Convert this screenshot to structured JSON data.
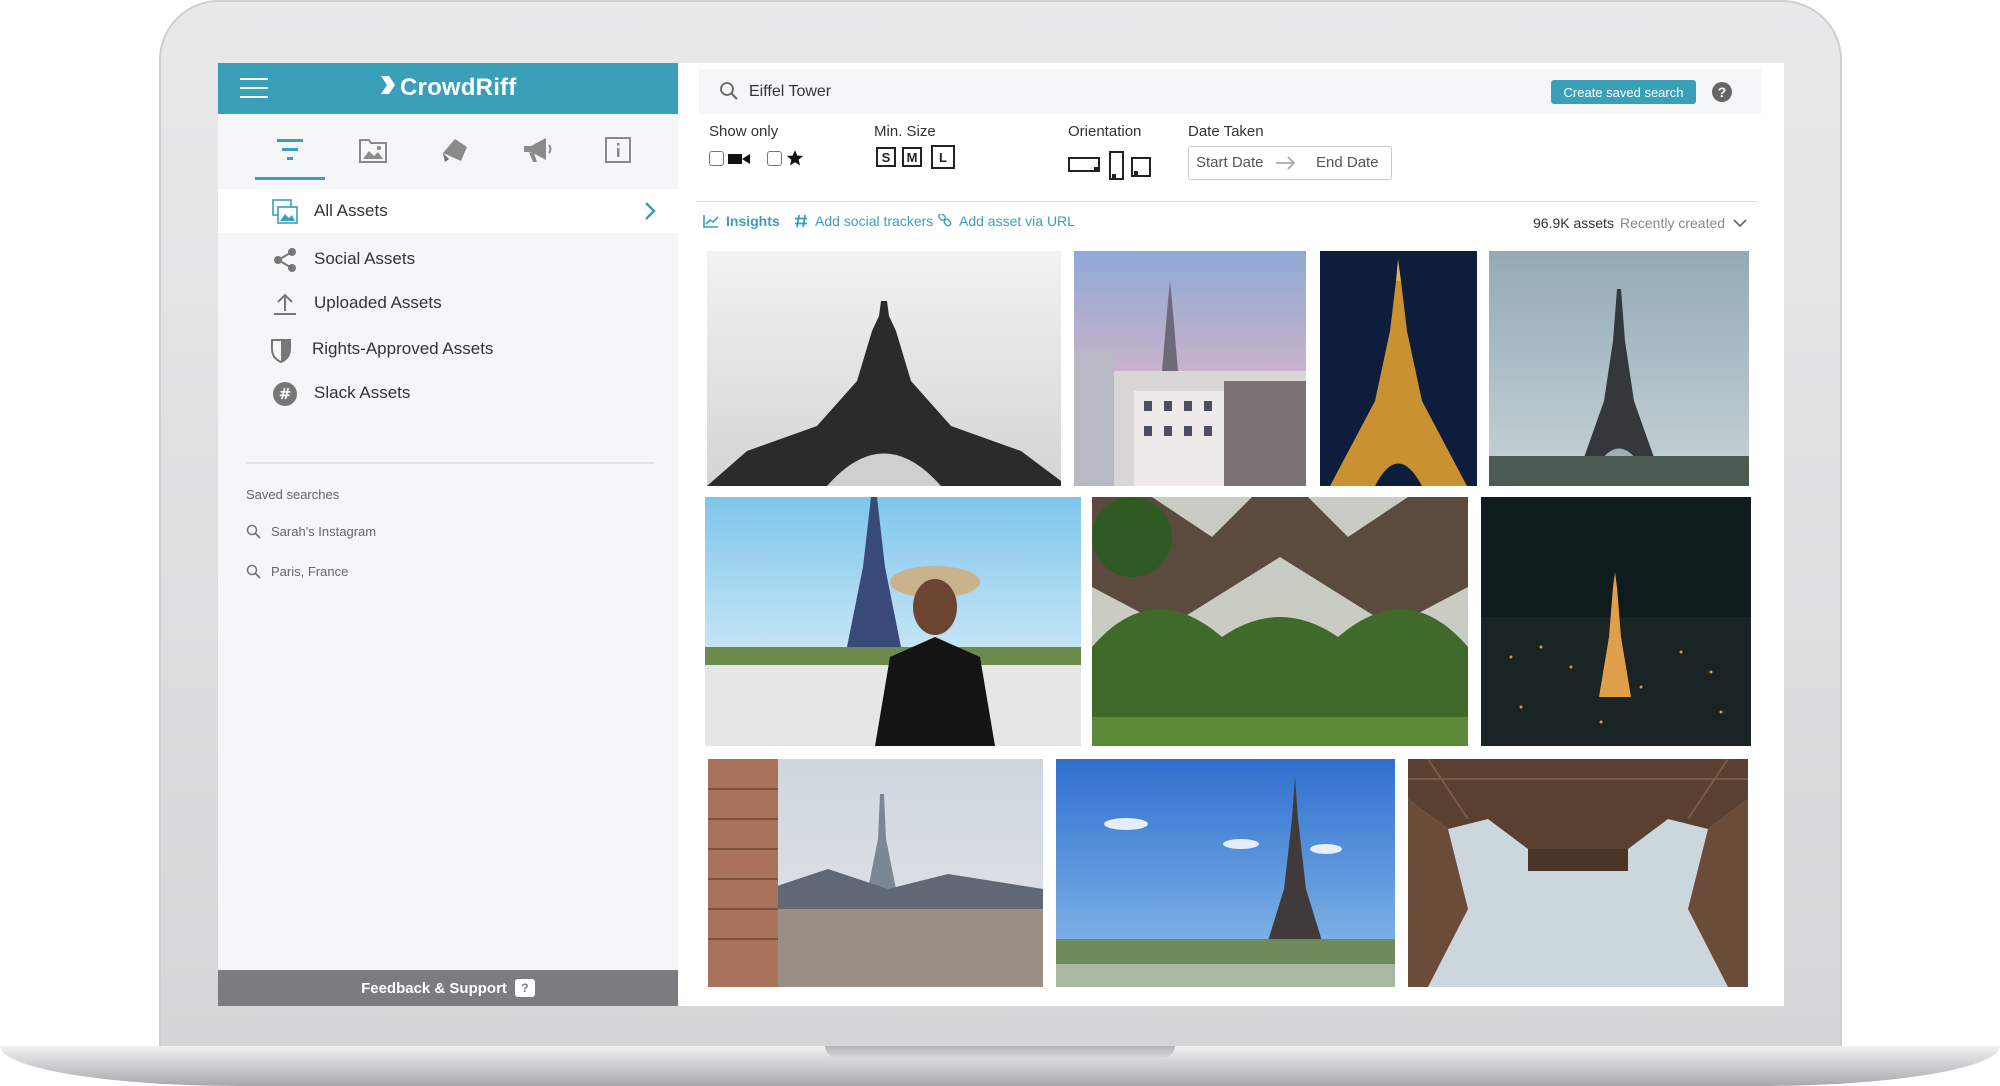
{
  "brand": {
    "name": "CrowdRiff"
  },
  "sidebar": {
    "nav": [
      {
        "label": "All Assets"
      },
      {
        "label": "Social Assets"
      },
      {
        "label": "Uploaded Assets"
      },
      {
        "label": "Rights-Approved Assets"
      },
      {
        "label": "Slack Assets"
      }
    ],
    "saved_searches_title": "Saved searches",
    "saved_searches": [
      {
        "label": "Sarah's Instagram"
      },
      {
        "label": "Paris, France"
      }
    ],
    "footer_label": "Feedback & Support",
    "footer_badge": "?"
  },
  "search": {
    "value": "Eiffel Tower",
    "saved_button": "Create saved search",
    "help": "?"
  },
  "filters": {
    "show_only": "Show only",
    "min_size": "Min. Size",
    "sizes": [
      "S",
      "M",
      "L"
    ],
    "orientation": "Orientation",
    "date_taken": "Date Taken",
    "start_date": "Start Date",
    "end_date": "End Date"
  },
  "actions": {
    "insights": "Insights",
    "add_social_trackers": "Add social trackers",
    "add_asset_via_url": "Add asset via URL"
  },
  "results": {
    "count": "96.9K assets",
    "sort": "Recently created"
  },
  "colors": {
    "accent": "#3a9fb8",
    "sidebar_bg": "#f5f6f8",
    "footer_bg": "#7a7c80"
  }
}
